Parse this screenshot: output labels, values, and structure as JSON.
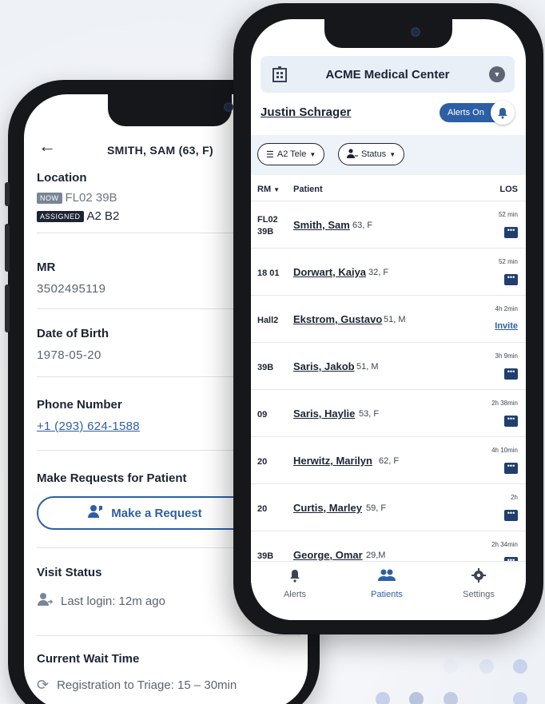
{
  "back_phone": {
    "title": "SMITH, SAM (63, F)",
    "location": {
      "label": "Location",
      "now_tag": "NOW",
      "now_value": "FL02 39B",
      "assigned_tag": "ASSIGNED",
      "assigned_value": "A2 B2"
    },
    "mr": {
      "label": "MR",
      "value": "3502495119"
    },
    "dob": {
      "label": "Date of Birth",
      "value": "1978-05-20"
    },
    "phone": {
      "label": "Phone Number",
      "value": "+1 (293) 624-1588"
    },
    "requests": {
      "label": "Make Requests for Patient",
      "button_label": "Make a Request"
    },
    "visit_status": {
      "label": "Visit Status",
      "value": "Last login: 12m ago"
    },
    "wait_time": {
      "label": "Current Wait Time",
      "value": "Registration to Triage: 15 – 30min"
    }
  },
  "front_phone": {
    "hospital": "ACME Medical Center",
    "user": "Justin Schrager",
    "alerts_toggle": "Alerts On",
    "filters": [
      {
        "label": "A2 Tele"
      },
      {
        "label": "Status"
      }
    ],
    "table_headers": {
      "rm": "RM",
      "patient": "Patient",
      "los": "LOS"
    },
    "rows": [
      {
        "room": "FL02\n39B",
        "name": "Smith, Sam",
        "meta": "63, F",
        "los": "52 min",
        "action": "message"
      },
      {
        "room": "18 01",
        "name": "Dorwart, Kaiya",
        "meta": "32, F",
        "los": "52 min",
        "action": "message"
      },
      {
        "room": "Hall2",
        "name": "Ekstrom, Gustavo",
        "meta": "51, M",
        "los": "4h 2min",
        "action": "Invite"
      },
      {
        "room": "39B",
        "name": "Saris, Jakob",
        "meta": "51, M",
        "los": "3h 9min",
        "action": "message"
      },
      {
        "room": "09",
        "name": "Saris, Haylie",
        "meta": "53, F",
        "los": "2h 38min",
        "action": "message"
      },
      {
        "room": "20",
        "name": "Herwitz, Marilyn",
        "meta": "62, F",
        "los": "4h 10min",
        "action": "message"
      },
      {
        "room": "20",
        "name": "Curtis, Marley",
        "meta": "59, F",
        "los": "2h",
        "action": "message"
      },
      {
        "room": "39B",
        "name": "George, Omar",
        "meta": "29,M",
        "los": "2h 34min",
        "action": "message"
      }
    ],
    "tabs": [
      {
        "label": "Alerts",
        "icon": "bell-icon"
      },
      {
        "label": "Patients",
        "icon": "people-icon"
      },
      {
        "label": "Settings",
        "icon": "gear-icon"
      }
    ],
    "active_tab": "Patients"
  },
  "colors": {
    "accent": "#2d5fa5",
    "dark": "#1c2434",
    "filter_bg": "#edf3f8"
  }
}
